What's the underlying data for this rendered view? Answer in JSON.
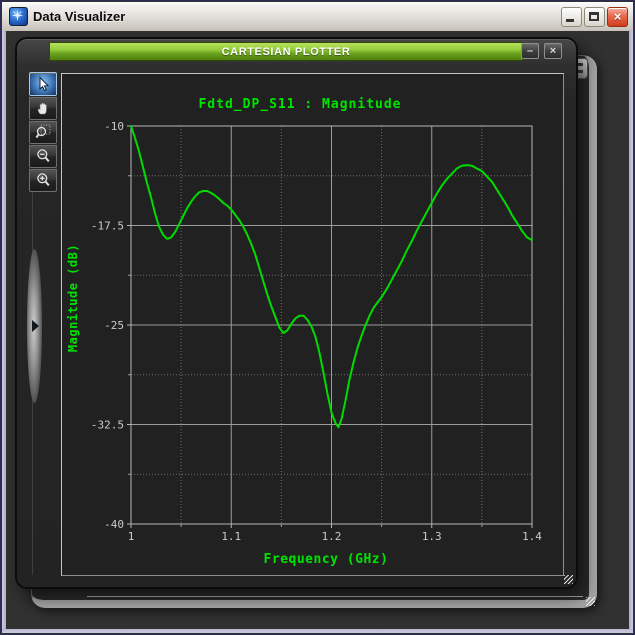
{
  "outer_window": {
    "title": "Data Visualizer",
    "close_glyph": "×",
    "minimize_label": "minimize",
    "maximize_label": "maximize"
  },
  "plotter_window": {
    "title": "CARTESIAN PLOTTER",
    "minimize_glyph": "–",
    "close_glyph": "×"
  },
  "toolbar": {
    "tools": [
      {
        "name": "select-pointer",
        "selected": true
      },
      {
        "name": "pan-hand",
        "selected": false
      },
      {
        "name": "zoom-region",
        "selected": false
      },
      {
        "name": "zoom-out",
        "selected": false
      },
      {
        "name": "zoom-in",
        "selected": false
      }
    ]
  },
  "colors": {
    "titlebar_green_top": "#b9e05c",
    "titlebar_green_bottom": "#517f0e",
    "plot_text_green": "#00e400",
    "curve_green": "#00dc00",
    "close_red": "#cf3c1e",
    "plot_bg": "#212121",
    "grid_major": "#9c9c9c",
    "grid_minor": "#6f6f6f",
    "axis_box": "#b8b8b8",
    "tick_text": "#cacaca"
  },
  "chart_data": {
    "type": "line",
    "title": "Fdtd_DP_S11 : Magnitude",
    "xlabel": "Frequency (GHz)",
    "ylabel": "Magnitude (dB)",
    "xlim": [
      1.0,
      1.4
    ],
    "ylim": [
      -40,
      -10
    ],
    "x_major_ticks": [
      1,
      1.1,
      1.2,
      1.3,
      1.4
    ],
    "x_tick_labels": [
      "1",
      "1.1",
      "1.2",
      "1.3",
      "1.4"
    ],
    "x_minor_ticks": [
      1.05,
      1.15,
      1.25,
      1.35
    ],
    "y_major_ticks": [
      -10,
      -17.5,
      -25,
      -32.5,
      -40
    ],
    "y_tick_labels": [
      "-10",
      "-17.5",
      "-25",
      "-32.5",
      "-40"
    ],
    "y_minor_ticks": [
      -13.75,
      -21.25,
      -28.75,
      -36.25
    ],
    "grid": true,
    "legend": "none",
    "line_color": "#00dc00",
    "series": [
      {
        "name": "Fdtd_DP_S11",
        "points": [
          [
            1.0,
            -10.0
          ],
          [
            1.004,
            -10.9
          ],
          [
            1.008,
            -11.9
          ],
          [
            1.012,
            -13.1
          ],
          [
            1.016,
            -14.3
          ],
          [
            1.02,
            -15.4
          ],
          [
            1.024,
            -16.6
          ],
          [
            1.028,
            -17.6
          ],
          [
            1.032,
            -18.2
          ],
          [
            1.036,
            -18.5
          ],
          [
            1.04,
            -18.4
          ],
          [
            1.044,
            -18.0
          ],
          [
            1.048,
            -17.4
          ],
          [
            1.052,
            -16.8
          ],
          [
            1.056,
            -16.2
          ],
          [
            1.06,
            -15.7
          ],
          [
            1.064,
            -15.3
          ],
          [
            1.068,
            -15.0
          ],
          [
            1.072,
            -14.9
          ],
          [
            1.076,
            -14.9
          ],
          [
            1.08,
            -15.05
          ],
          [
            1.084,
            -15.25
          ],
          [
            1.088,
            -15.5
          ],
          [
            1.092,
            -15.8
          ],
          [
            1.096,
            -16.0
          ],
          [
            1.1,
            -16.3
          ],
          [
            1.104,
            -16.7
          ],
          [
            1.108,
            -17.1
          ],
          [
            1.112,
            -17.6
          ],
          [
            1.116,
            -18.2
          ],
          [
            1.12,
            -18.9
          ],
          [
            1.124,
            -19.7
          ],
          [
            1.128,
            -20.7
          ],
          [
            1.132,
            -21.7
          ],
          [
            1.136,
            -22.7
          ],
          [
            1.14,
            -23.6
          ],
          [
            1.144,
            -24.4
          ],
          [
            1.148,
            -25.2
          ],
          [
            1.152,
            -25.6
          ],
          [
            1.156,
            -25.4
          ],
          [
            1.16,
            -24.9
          ],
          [
            1.164,
            -24.5
          ],
          [
            1.168,
            -24.3
          ],
          [
            1.172,
            -24.3
          ],
          [
            1.176,
            -24.6
          ],
          [
            1.18,
            -25.1
          ],
          [
            1.184,
            -25.9
          ],
          [
            1.188,
            -27.1
          ],
          [
            1.192,
            -28.6
          ],
          [
            1.196,
            -30.2
          ],
          [
            1.2,
            -31.6
          ],
          [
            1.204,
            -32.4
          ],
          [
            1.207,
            -32.7
          ],
          [
            1.21,
            -32.1
          ],
          [
            1.214,
            -30.7
          ],
          [
            1.218,
            -29.1
          ],
          [
            1.222,
            -27.8
          ],
          [
            1.226,
            -26.7
          ],
          [
            1.23,
            -25.8
          ],
          [
            1.234,
            -25.0
          ],
          [
            1.238,
            -24.3
          ],
          [
            1.242,
            -23.7
          ],
          [
            1.246,
            -23.3
          ],
          [
            1.25,
            -22.9
          ],
          [
            1.255,
            -22.3
          ],
          [
            1.26,
            -21.6
          ],
          [
            1.265,
            -20.9
          ],
          [
            1.27,
            -20.2
          ],
          [
            1.275,
            -19.4
          ],
          [
            1.28,
            -18.7
          ],
          [
            1.285,
            -17.9
          ],
          [
            1.29,
            -17.2
          ],
          [
            1.295,
            -16.5
          ],
          [
            1.3,
            -15.8
          ],
          [
            1.305,
            -15.1
          ],
          [
            1.31,
            -14.5
          ],
          [
            1.315,
            -14.0
          ],
          [
            1.32,
            -13.6
          ],
          [
            1.325,
            -13.2
          ],
          [
            1.33,
            -13.0
          ],
          [
            1.335,
            -12.95
          ],
          [
            1.34,
            -13.0
          ],
          [
            1.345,
            -13.2
          ],
          [
            1.35,
            -13.4
          ],
          [
            1.355,
            -13.8
          ],
          [
            1.36,
            -14.2
          ],
          [
            1.365,
            -14.8
          ],
          [
            1.37,
            -15.4
          ],
          [
            1.375,
            -16.0
          ],
          [
            1.38,
            -16.7
          ],
          [
            1.385,
            -17.3
          ],
          [
            1.39,
            -17.9
          ],
          [
            1.395,
            -18.4
          ],
          [
            1.4,
            -18.6
          ]
        ]
      }
    ]
  }
}
